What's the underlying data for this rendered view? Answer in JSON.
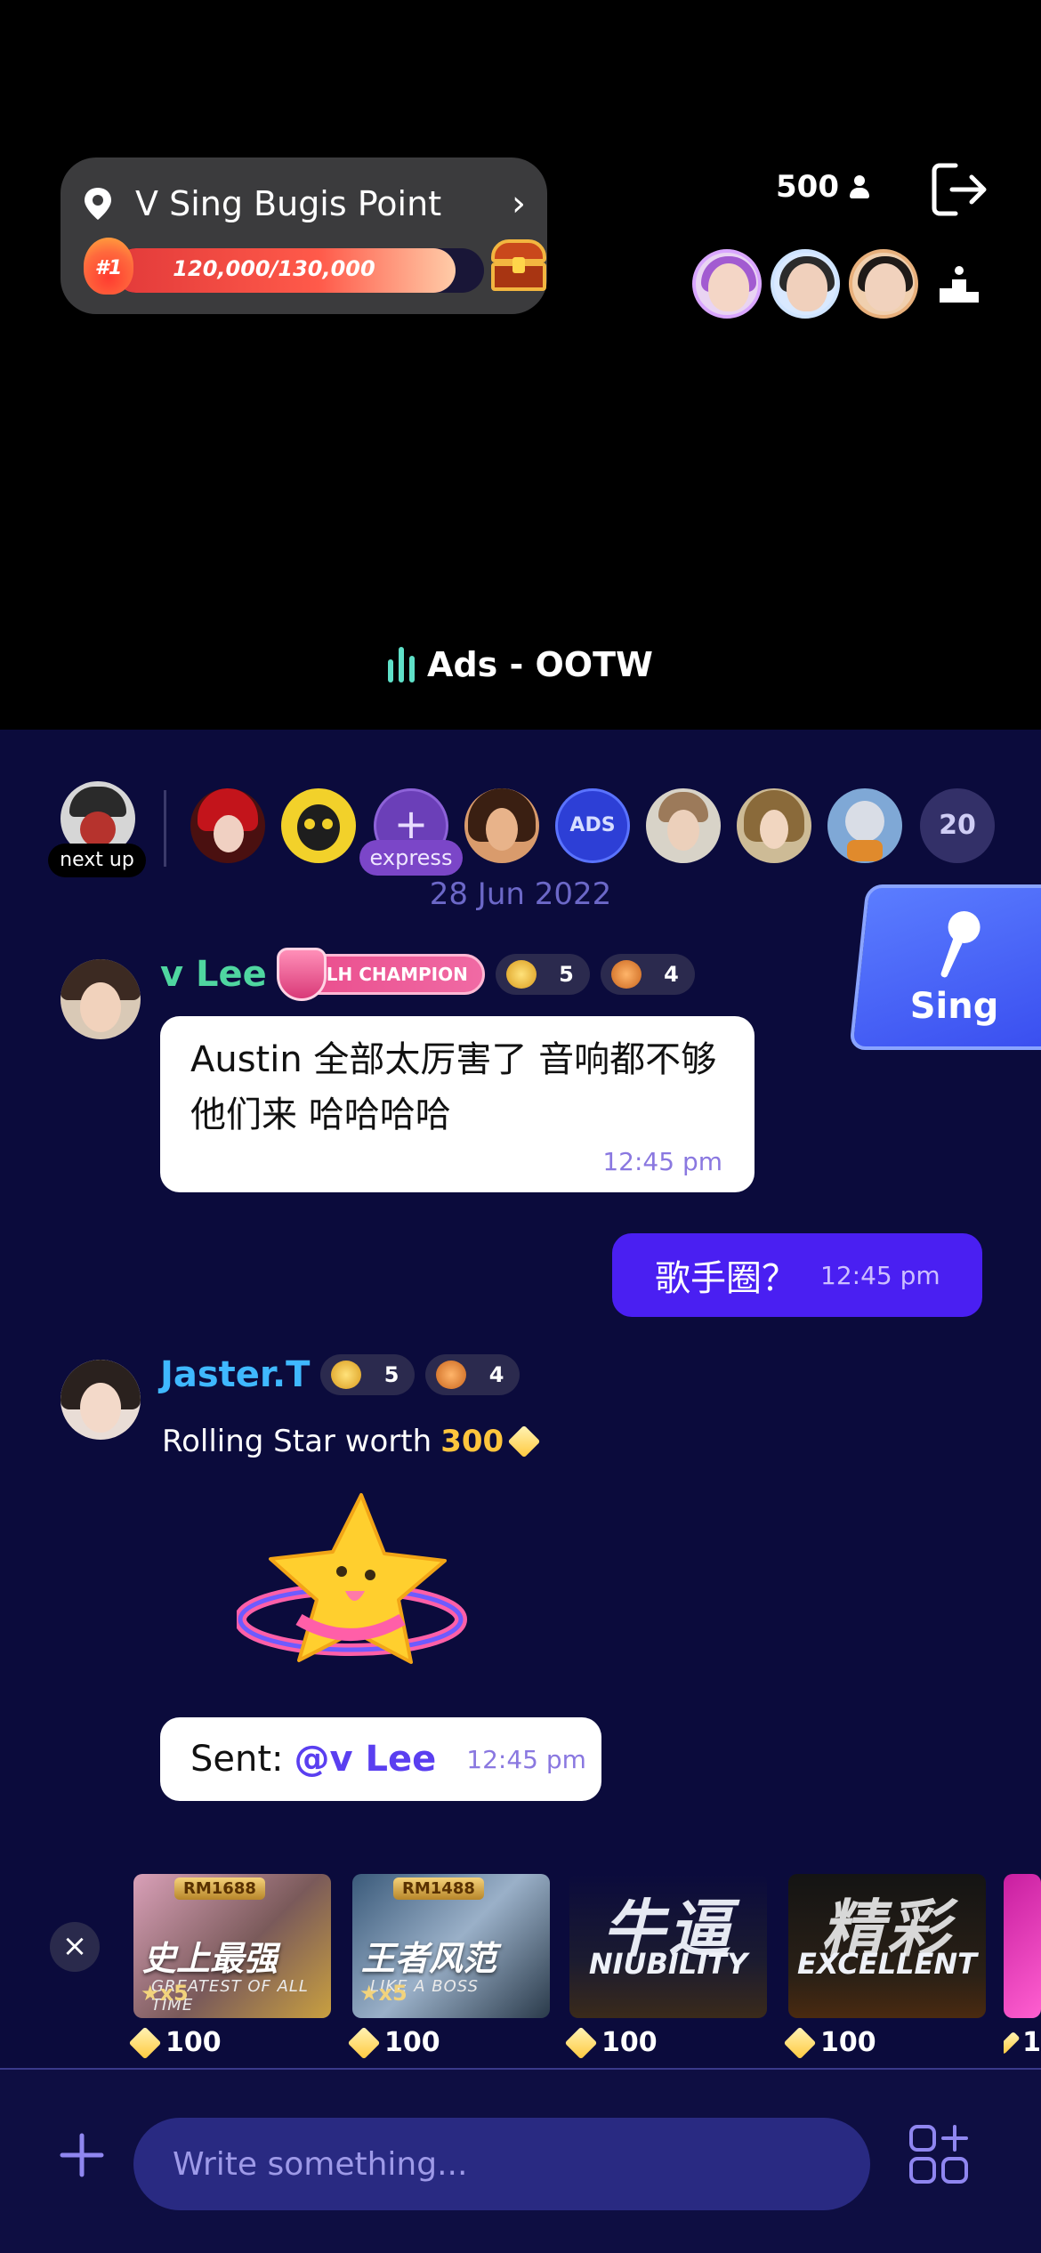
{
  "venue": {
    "name": "V Sing Bugis Point",
    "rank": "#1",
    "progress_text": "120,000/130,000",
    "progress_fraction": 0.923
  },
  "viewer_count": "500",
  "stream_title": "Ads - OOTW",
  "queue": {
    "next_label": "next up",
    "express_label": "express",
    "ads_label": "ADS",
    "count": "20"
  },
  "date_separator": "28 Jun 2022",
  "sing_button": "Sing",
  "messages": {
    "m1": {
      "user": "v Lee",
      "user_color": "#4fd6a0",
      "champion_badge": "LH CHAMPION",
      "level_a": "5",
      "level_b": "4",
      "text": "Austin 全部太厉害了 音响都不够他们来 哈哈哈哈",
      "time": "12:45 pm"
    },
    "m2": {
      "text": "歌手圈？",
      "time": "12:45 pm"
    },
    "m3": {
      "user": "Jaster.T",
      "user_color": "#3fb8ff",
      "level_a": "5",
      "level_b": "4",
      "gift_prefix": "Rolling Star worth",
      "gift_amount": "300",
      "sent_prefix": "Sent:",
      "sent_to": "@v Lee",
      "time": "12:45 pm"
    }
  },
  "gifts": [
    {
      "tag": "RM1688",
      "title": "史上最强",
      "sub": "GREATEST OF ALL TIME",
      "x": "x5",
      "price": "100"
    },
    {
      "tag": "RM1488",
      "title": "王者风范",
      "sub": "LIKE A BOSS",
      "x": "x5",
      "price": "100"
    },
    {
      "title": "牛逼",
      "eng": "NIUBILITY",
      "price": "100"
    },
    {
      "title": "精彩",
      "eng": "EXCELLENT",
      "price": "100"
    },
    {
      "price": "1"
    }
  ],
  "input": {
    "placeholder": "Write something..."
  },
  "colors": {
    "panel": "#0b0b3c",
    "my_bubble": "#4a1ff2",
    "accent_gold": "#ffc53d"
  }
}
